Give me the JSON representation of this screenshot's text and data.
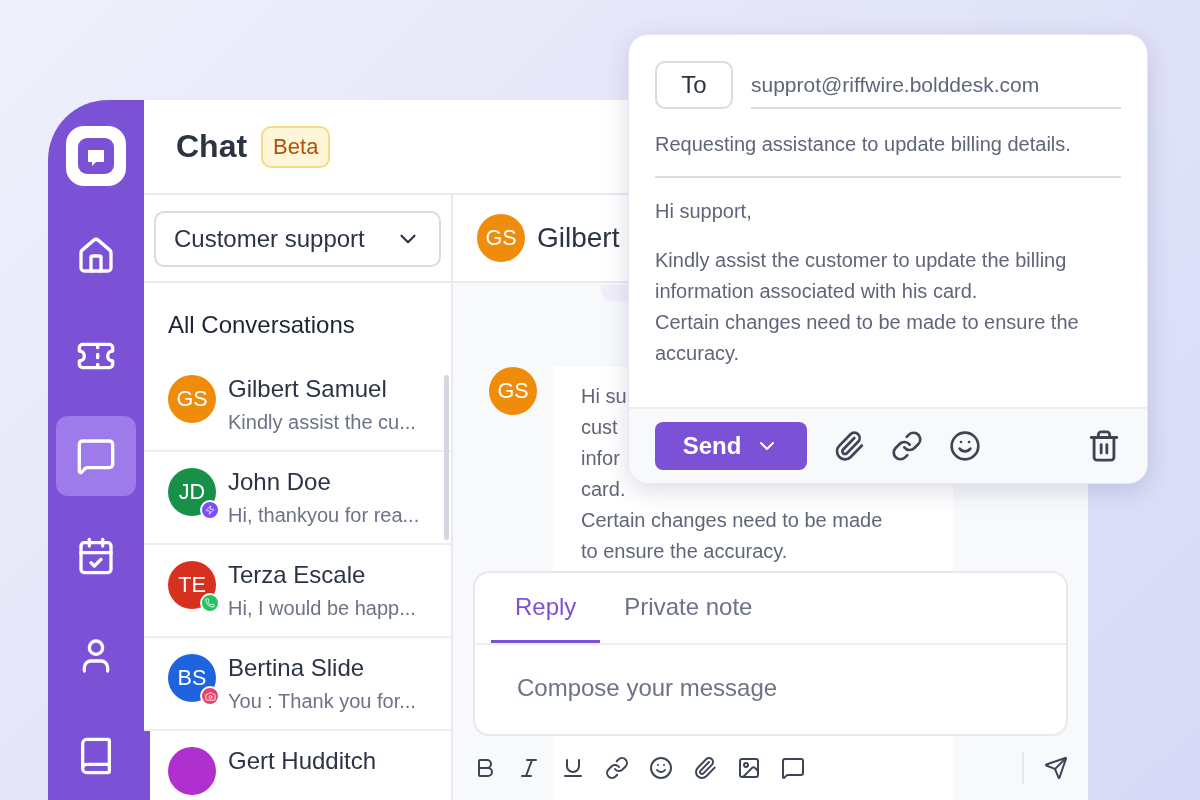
{
  "nav": [
    {
      "kind": "logo",
      "selected": false
    },
    {
      "kind": "home",
      "selected": false
    },
    {
      "kind": "ticket",
      "selected": false
    },
    {
      "kind": "chat",
      "selected": true
    },
    {
      "kind": "calendar",
      "selected": false
    },
    {
      "kind": "user",
      "selected": false
    },
    {
      "kind": "book",
      "selected": false
    }
  ],
  "header": {
    "title": "Chat",
    "badge": "Beta"
  },
  "filter": {
    "value": "Customer support"
  },
  "list_title": "All Conversations",
  "conversations": [
    {
      "initials": "GS",
      "color": "#f08c0c",
      "name": "Gilbert Samuel",
      "preview": "Kindly assist the cu...",
      "kind": "plain",
      "selected": false
    },
    {
      "initials": "JD",
      "color": "#179048",
      "name": "John Doe",
      "preview": "Hi, thankyou for rea...",
      "kind": "messenger",
      "selected": false
    },
    {
      "initials": "TE",
      "color": "#d8301e",
      "name": "Terza Escale",
      "preview": "Hi, I would be happ...",
      "kind": "whatsapp",
      "selected": false
    },
    {
      "initials": "BS",
      "color": "#1e63e0",
      "name": "Bertina Slide",
      "preview": "You : Thank you for...",
      "kind": "instagram",
      "selected": false
    },
    {
      "color": "#b02fcf",
      "name": "Gert Hudditch",
      "kind": "plain",
      "selected": true
    }
  ],
  "chat": {
    "initials": "GS",
    "color": "#f08c0c",
    "name": "Gilbert",
    "message": {
      "initials": "GS",
      "lines": [
        "Hi su",
        "cust",
        "infor",
        "card.",
        "Certain changes need to be made",
        "to ensure the accuracy."
      ]
    }
  },
  "compose": {
    "tabs": [
      {
        "label": "Reply",
        "selected": true
      },
      {
        "label": "Private note",
        "selected": false
      }
    ],
    "placeholder": "Compose your message"
  },
  "email": {
    "to_label": "To",
    "to_value": "supprot@riffwire.bolddesk.com",
    "subject": "Requesting assistance to update billing details.",
    "body": [
      "Hi support,",
      "Kindly assist the customer to update the billing information associated with his card.\nCertain changes need to be made to ensure the accuracy."
    ],
    "send": "Send"
  }
}
